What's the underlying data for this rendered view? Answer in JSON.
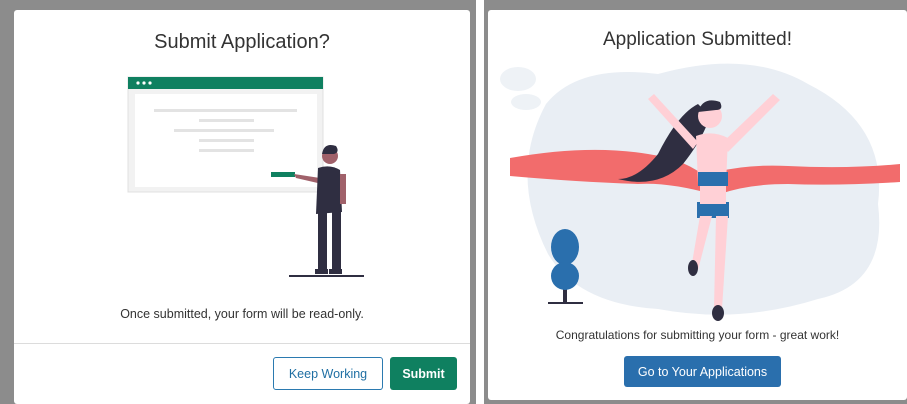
{
  "confirm_dialog": {
    "title": "Submit Application?",
    "message": "Once submitted, your form will be read-only.",
    "keep_working_label": "Keep Working",
    "submit_label": "Submit"
  },
  "success_dialog": {
    "title": "Application Submitted!",
    "message": "Congratulations for submitting your form - great work!",
    "go_label": "Go to Your Applications"
  },
  "colors": {
    "submit_green": "#0f8060",
    "primary_blue": "#2a6fad",
    "ribbon_red": "#f26c6c",
    "illustration_dark": "#2f2e41"
  },
  "icons": [
    "presentation-illustration",
    "finish-line-runner-illustration"
  ]
}
